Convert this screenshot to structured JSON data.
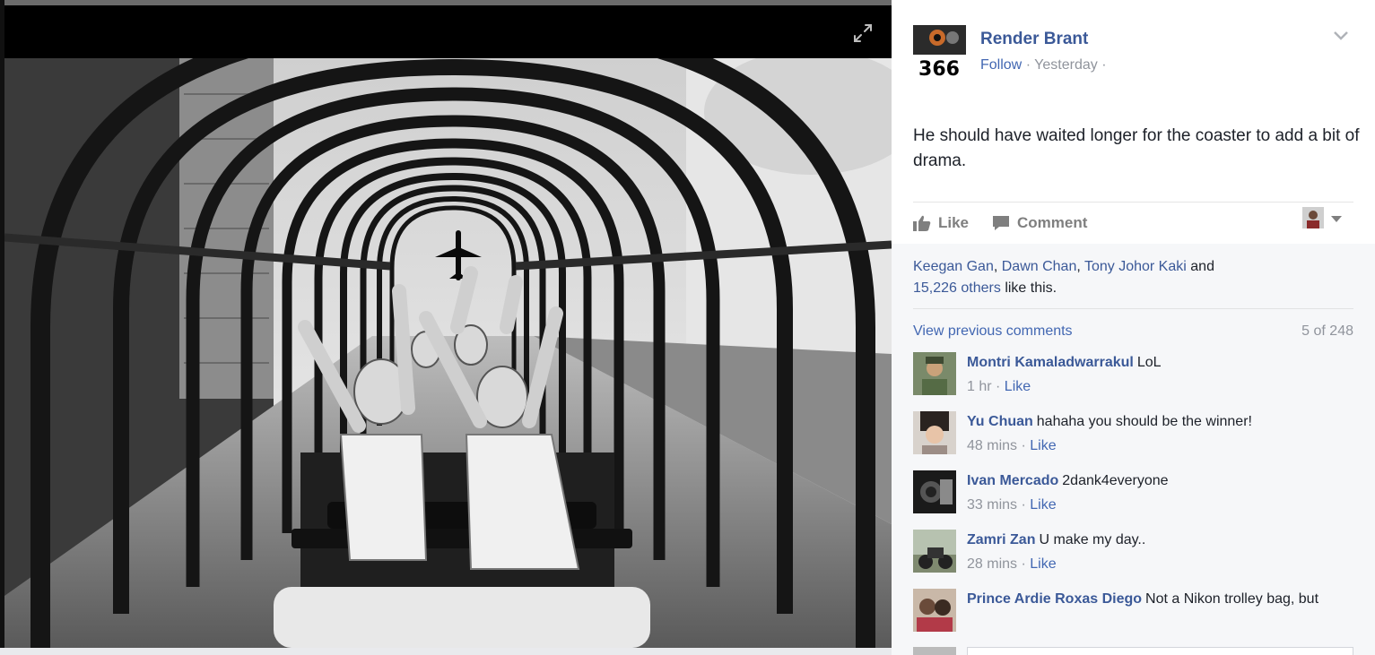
{
  "post": {
    "author": "Render Brant",
    "avatar_text": "366",
    "follow": "Follow",
    "time": "Yesterday",
    "sep": "·",
    "text": "He should have waited longer for the coaster to add a bit of drama."
  },
  "actions": {
    "like": "Like",
    "comment": "Comment"
  },
  "likes": {
    "names": [
      "Keegan Gan",
      "Dawn Chan",
      "Tony Johor Kaki"
    ],
    "and": "and",
    "others": "15,226 others",
    "suffix": "like this."
  },
  "comments_header": {
    "view_previous": "View previous comments",
    "count": "5 of 248"
  },
  "comments": [
    {
      "name": "Montri Kamaladwarrakul",
      "text": "LoL",
      "time": "1 hr",
      "like": "Like"
    },
    {
      "name": "Yu Chuan",
      "text": "hahaha you should be the winner!",
      "time": "48 mins",
      "like": "Like"
    },
    {
      "name": "Ivan Mercado",
      "text": "2dank4everyone",
      "time": "33 mins",
      "like": "Like"
    },
    {
      "name": "Zamri Zan",
      "text": "U make my day..",
      "time": "28 mins",
      "like": "Like"
    },
    {
      "name": "Prince Ardie Roxas Diego",
      "text": "Not a Nikon trolley bag, but",
      "time": "",
      "like": ""
    }
  ],
  "colors": {
    "link": "#3b5998",
    "meta": "#90949c",
    "sidebar_bg": "#f6f7f9"
  }
}
